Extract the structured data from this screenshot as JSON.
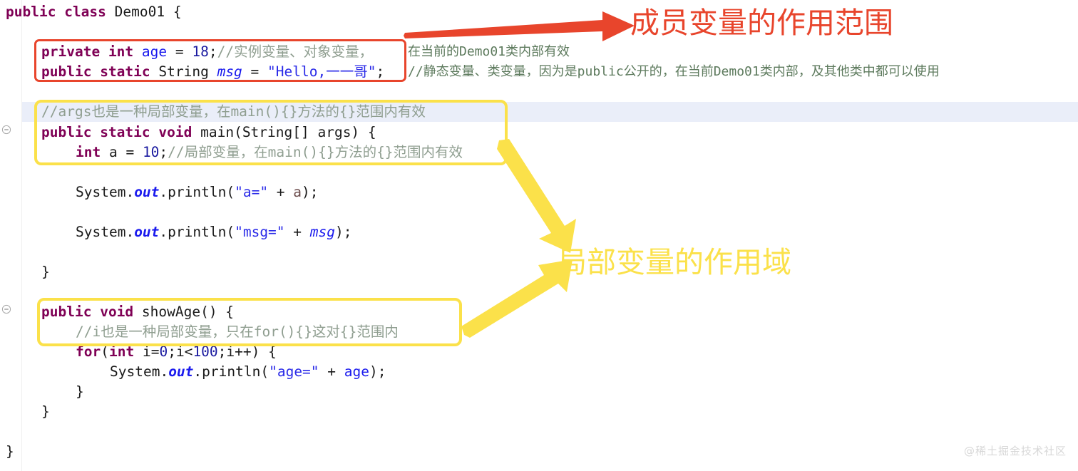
{
  "editor": {
    "language": "java",
    "background": "#ffffff",
    "current_line_highlight_color": "#eaeef9",
    "fold_icons": [
      {
        "name": "fold-collapse-icon",
        "row": "main-method"
      },
      {
        "name": "fold-collapse-icon",
        "row": "showage-method"
      }
    ],
    "code_lines": [
      {
        "id": "class-decl",
        "indent": 0,
        "tokens": [
          {
            "text": "public",
            "kind": "keyword"
          },
          {
            "text": " ",
            "kind": "plain"
          },
          {
            "text": "class",
            "kind": "keyword"
          },
          {
            "text": " Demo01 {",
            "kind": "plain"
          }
        ]
      },
      {
        "id": "field-age",
        "indent": 1,
        "tokens": [
          {
            "text": "private",
            "kind": "keyword"
          },
          {
            "text": " ",
            "kind": "plain"
          },
          {
            "text": "int",
            "kind": "keyword"
          },
          {
            "text": " ",
            "kind": "plain"
          },
          {
            "text": "age",
            "kind": "field"
          },
          {
            "text": " = ",
            "kind": "plain"
          },
          {
            "text": "18",
            "kind": "number"
          },
          {
            "text": ";",
            "kind": "plain"
          },
          {
            "text": "//实例变量、对象变量，",
            "kind": "comment"
          }
        ],
        "comment_tail": "在当前的Demo01类内部有效"
      },
      {
        "id": "field-msg",
        "indent": 1,
        "tokens": [
          {
            "text": "public",
            "kind": "keyword"
          },
          {
            "text": " ",
            "kind": "plain"
          },
          {
            "text": "static",
            "kind": "keyword"
          },
          {
            "text": " String ",
            "kind": "plain"
          },
          {
            "text": "msg",
            "kind": "field-italic"
          },
          {
            "text": " = ",
            "kind": "plain"
          },
          {
            "text": "\"Hello,一一哥\"",
            "kind": "string"
          },
          {
            "text": ";",
            "kind": "plain"
          }
        ],
        "comment_tail": "//静态变量、类变量，因为是public公开的，在当前Demo01类内部，及其他类中都可以使用"
      },
      {
        "id": "comment-args",
        "indent": 1,
        "highlighted": true,
        "tokens": [
          {
            "text": "//args也是一种局部变量，在main(){}方法的{}范围内有效",
            "kind": "comment"
          }
        ]
      },
      {
        "id": "main-decl",
        "indent": 1,
        "tokens": [
          {
            "text": "public",
            "kind": "keyword"
          },
          {
            "text": " ",
            "kind": "plain"
          },
          {
            "text": "static",
            "kind": "keyword"
          },
          {
            "text": " ",
            "kind": "plain"
          },
          {
            "text": "void",
            "kind": "keyword"
          },
          {
            "text": " main(String[] args) {",
            "kind": "plain"
          }
        ]
      },
      {
        "id": "local-a",
        "indent": 2,
        "tokens": [
          {
            "text": "int",
            "kind": "keyword"
          },
          {
            "text": " a = ",
            "kind": "plain"
          },
          {
            "text": "10",
            "kind": "number"
          },
          {
            "text": ";",
            "kind": "plain"
          },
          {
            "text": "//局部变量，在main(){}方法的{}范围内有效",
            "kind": "comment"
          }
        ]
      },
      {
        "id": "print-a",
        "indent": 2,
        "tokens": [
          {
            "text": "System.",
            "kind": "plain"
          },
          {
            "text": "out",
            "kind": "static-italic"
          },
          {
            "text": ".println(",
            "kind": "plain"
          },
          {
            "text": "\"a=\"",
            "kind": "string"
          },
          {
            "text": " + ",
            "kind": "plain"
          },
          {
            "text": "a",
            "kind": "local"
          },
          {
            "text": ");",
            "kind": "plain"
          }
        ]
      },
      {
        "id": "print-msg",
        "indent": 2,
        "tokens": [
          {
            "text": "System.",
            "kind": "plain"
          },
          {
            "text": "out",
            "kind": "static-italic"
          },
          {
            "text": ".println(",
            "kind": "plain"
          },
          {
            "text": "\"msg=\"",
            "kind": "string"
          },
          {
            "text": " + ",
            "kind": "plain"
          },
          {
            "text": "msg",
            "kind": "field-italic"
          },
          {
            "text": ");",
            "kind": "plain"
          }
        ]
      },
      {
        "id": "main-close",
        "indent": 1,
        "tokens": [
          {
            "text": "}",
            "kind": "plain"
          }
        ]
      },
      {
        "id": "showage-decl",
        "indent": 1,
        "tokens": [
          {
            "text": "public",
            "kind": "keyword"
          },
          {
            "text": " ",
            "kind": "plain"
          },
          {
            "text": "void",
            "kind": "keyword"
          },
          {
            "text": " showAge() {",
            "kind": "plain"
          }
        ]
      },
      {
        "id": "comment-i",
        "indent": 2,
        "tokens": [
          {
            "text": "//i也是一种局部变量，只在for(){}这对{}范围内",
            "kind": "comment"
          }
        ]
      },
      {
        "id": "for-loop",
        "indent": 2,
        "clipped": true,
        "tokens": [
          {
            "text": "for",
            "kind": "keyword"
          },
          {
            "text": "(",
            "kind": "plain"
          },
          {
            "text": "int",
            "kind": "keyword"
          },
          {
            "text": " i=",
            "kind": "plain"
          },
          {
            "text": "0",
            "kind": "number"
          },
          {
            "text": ";i<",
            "kind": "plain"
          },
          {
            "text": "100",
            "kind": "number"
          },
          {
            "text": ";i++) {",
            "kind": "plain"
          }
        ]
      },
      {
        "id": "print-age",
        "indent": 3,
        "tokens": [
          {
            "text": "System.",
            "kind": "plain"
          },
          {
            "text": "out",
            "kind": "static-italic"
          },
          {
            "text": ".println(",
            "kind": "plain"
          },
          {
            "text": "\"age=\"",
            "kind": "string"
          },
          {
            "text": " + ",
            "kind": "plain"
          },
          {
            "text": "age",
            "kind": "field"
          },
          {
            "text": ");",
            "kind": "plain"
          }
        ]
      },
      {
        "id": "for-close",
        "indent": 3,
        "tokens": [
          {
            "text": "}",
            "kind": "plain"
          }
        ]
      },
      {
        "id": "showage-close",
        "indent": 1,
        "tokens": [
          {
            "text": "}",
            "kind": "plain"
          }
        ]
      },
      {
        "id": "class-close",
        "indent": 0,
        "tokens": [
          {
            "text": "}",
            "kind": "plain"
          }
        ]
      }
    ]
  },
  "annotations": {
    "member_scope": {
      "box_color": "#e8452c",
      "arrow_color": "#e8452c",
      "label": "成员变量的作用范围",
      "highlights": [
        "field-age",
        "field-msg"
      ]
    },
    "local_scope": {
      "box_color": "#fbe14a",
      "arrow_color": "#fbe14a",
      "label": "局部变量的作用域",
      "highlights": [
        "comment-args",
        "main-decl",
        "local-a",
        "showage-decl",
        "comment-i"
      ]
    }
  },
  "watermark": {
    "text": "@稀土掘金技术社区"
  }
}
